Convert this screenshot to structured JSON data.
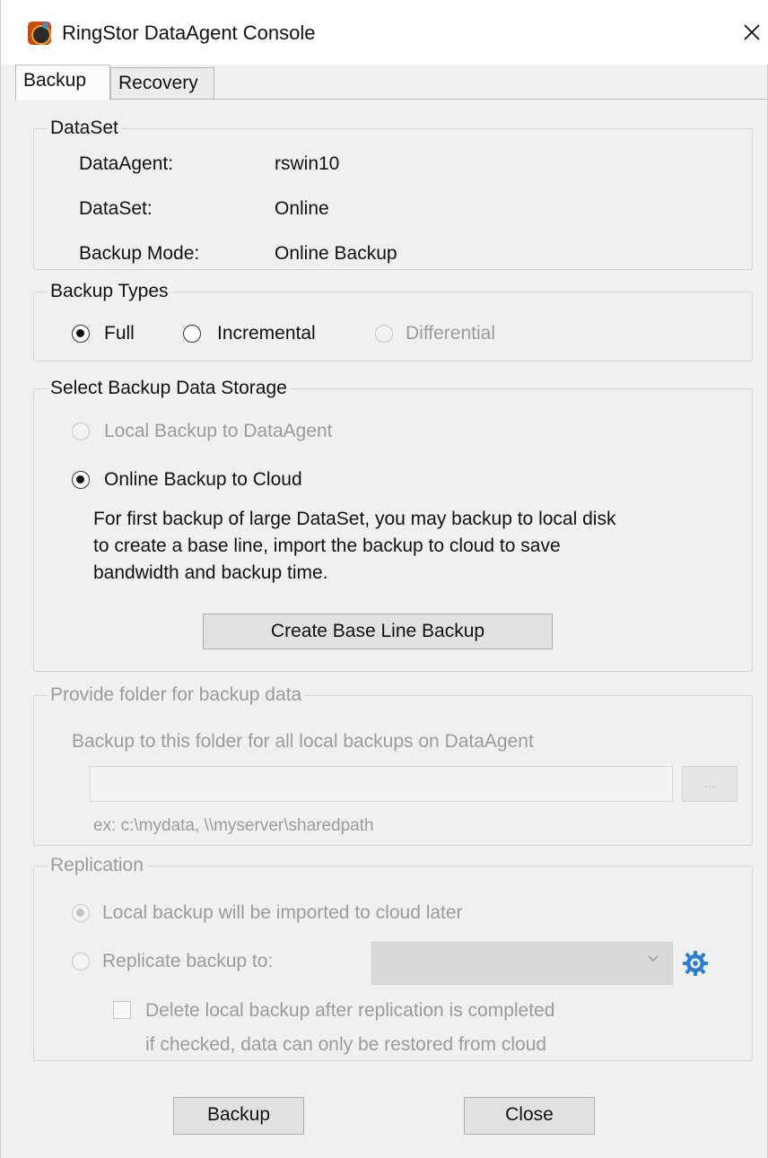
{
  "window": {
    "title": "RingStor DataAgent Console",
    "close_glyph": "✕",
    "icon": "app-logo-icon"
  },
  "tabs": [
    {
      "label": "Backup",
      "active": true
    },
    {
      "label": "Recovery",
      "active": false
    }
  ],
  "dataset_group": {
    "legend": "DataSet",
    "rows": [
      {
        "label": "DataAgent:",
        "value": "rswin10"
      },
      {
        "label": "DataSet:",
        "value": "Online"
      },
      {
        "label": "Backup Mode:",
        "value": "Online Backup"
      }
    ]
  },
  "backup_types": {
    "legend": "Backup Types",
    "options": [
      {
        "label": "Full",
        "checked": true,
        "enabled": true
      },
      {
        "label": "Incremental",
        "checked": false,
        "enabled": true
      },
      {
        "label": "Differential",
        "checked": false,
        "enabled": false
      }
    ]
  },
  "storage": {
    "legend": "Select Backup Data Storage",
    "local_option": "Local Backup to DataAgent",
    "online_option": "Online Backup to Cloud",
    "description_lines": [
      "For first backup of large DataSet, you may backup to local disk",
      "to create a base line, import the backup to cloud to save",
      "bandwidth and backup time."
    ],
    "baseline_button": "Create Base Line Backup"
  },
  "folder": {
    "legend": "Provide folder for backup data",
    "instruction": "Backup to this folder for all local backups on DataAgent",
    "input_value": "",
    "browse_label": "...",
    "example": "ex: c:\\mydata, \\\\myserver\\sharedpath"
  },
  "replication": {
    "legend": "Replication",
    "option_later": "Local backup will be imported to cloud later",
    "option_replicate": "Replicate backup to:",
    "target_value": "",
    "delete_label": "Delete local backup after replication is completed",
    "delete_note": "if checked, data can only be restored from cloud",
    "settings_icon": "gear-icon"
  },
  "footer": {
    "backup_button": "Backup",
    "close_button": "Close"
  },
  "colors": {
    "window_bg": "#f0f0f0",
    "disabled_text": "#9b9b9b",
    "gear_blue": "#2a7fd4"
  }
}
